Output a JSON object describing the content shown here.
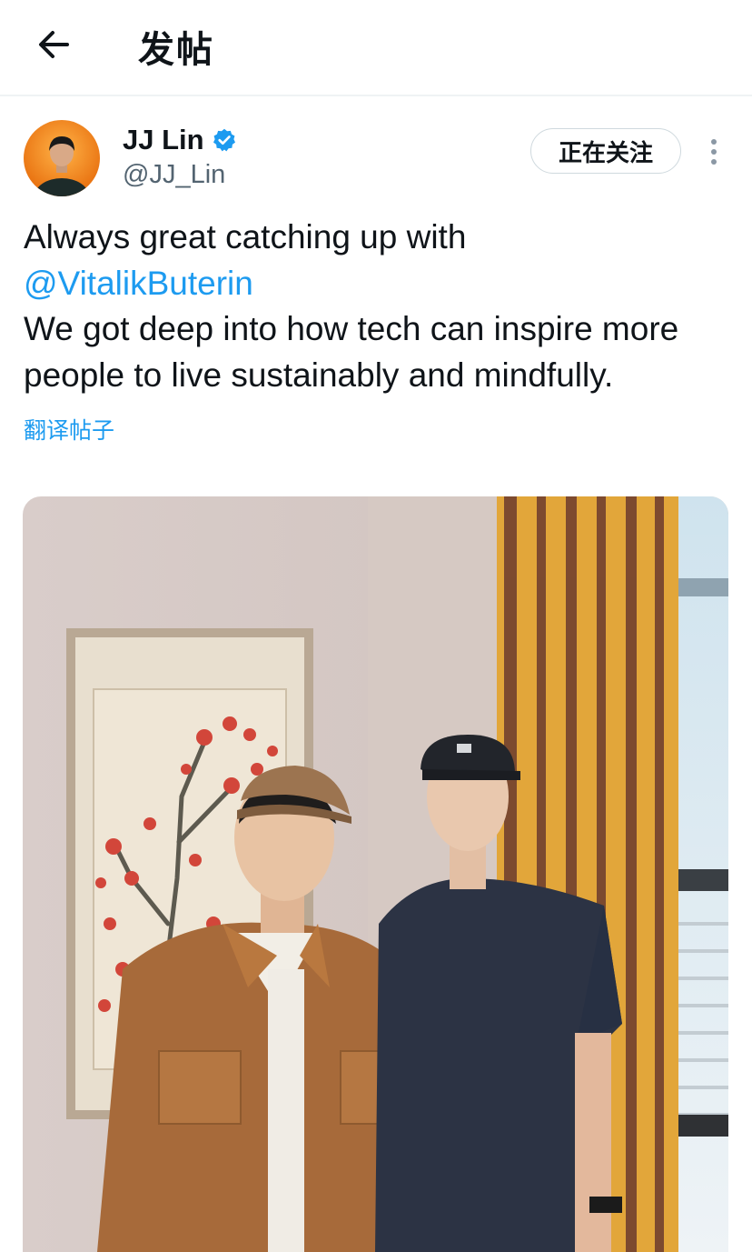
{
  "header": {
    "title": "发帖",
    "back_icon": "arrow-left-icon"
  },
  "author": {
    "name": "JJ Lin",
    "handle": "@JJ_Lin",
    "verified": true,
    "verified_color": "#1d9bf0",
    "follow_label": "正在关注"
  },
  "post": {
    "line1": "Always great catching up with",
    "mention": "@VitalikButerin",
    "line2": "We got deep into how tech can inspire more people to live sustainably and mindfully.",
    "translate_label": "翻译帖子"
  },
  "colors": {
    "accent": "#1d9bf0",
    "text": "#0f1419",
    "secondary": "#536471"
  }
}
